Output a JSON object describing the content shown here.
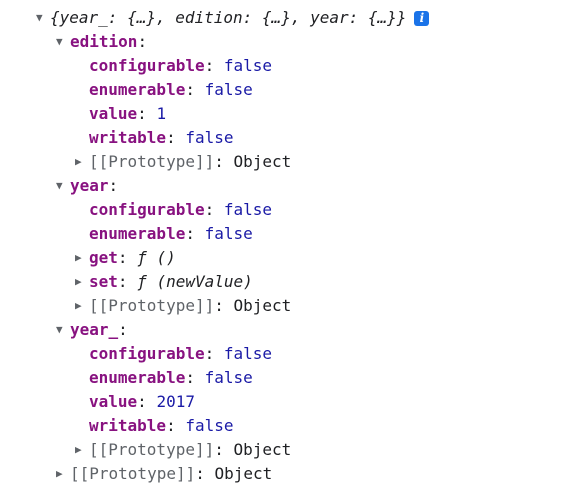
{
  "root": {
    "summary": "{year_: {…}, edition: {…}, year: {…}}",
    "info_glyph": "i"
  },
  "edition": {
    "key": "edition",
    "props": [
      {
        "key": "configurable",
        "value": "false"
      },
      {
        "key": "enumerable",
        "value": "false"
      },
      {
        "key": "value",
        "value": "1"
      },
      {
        "key": "writable",
        "value": "false"
      }
    ],
    "proto": {
      "key": "[[Prototype]]",
      "value": "Object"
    }
  },
  "year": {
    "key": "year",
    "props": [
      {
        "key": "configurable",
        "value": "false"
      },
      {
        "key": "enumerable",
        "value": "false"
      }
    ],
    "get": {
      "key": "get",
      "value": "ƒ ()"
    },
    "set": {
      "key": "set",
      "value": "ƒ (newValue)"
    },
    "proto": {
      "key": "[[Prototype]]",
      "value": "Object"
    }
  },
  "year_": {
    "key": "year_",
    "props": [
      {
        "key": "configurable",
        "value": "false"
      },
      {
        "key": "enumerable",
        "value": "false"
      },
      {
        "key": "value",
        "value": "2017"
      },
      {
        "key": "writable",
        "value": "false"
      }
    ],
    "proto": {
      "key": "[[Prototype]]",
      "value": "Object"
    }
  },
  "root_proto": {
    "key": "[[Prototype]]",
    "value": "Object"
  },
  "colors": {
    "key": "#881280",
    "primitive": "#1a1aa6",
    "info_badge": "#1a73e8"
  }
}
